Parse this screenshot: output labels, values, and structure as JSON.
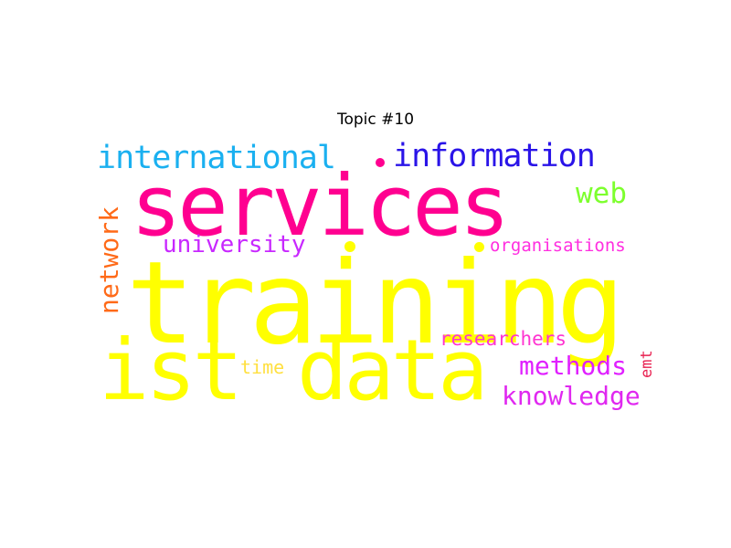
{
  "figure": {
    "title": "Topic #10"
  },
  "words": [
    {
      "text": "training",
      "color": "#ffff00"
    },
    {
      "text": "services",
      "color": "#ff0090"
    },
    {
      "text": "ist",
      "color": "#ffff00"
    },
    {
      "text": "data",
      "color": "#ffff00"
    },
    {
      "text": "international",
      "color": "#1ab0f0"
    },
    {
      "text": "information",
      "color": "#2a14e8"
    },
    {
      "text": "web",
      "color": "#7dff2e"
    },
    {
      "text": "network",
      "color": "#ff6a18"
    },
    {
      "text": "university",
      "color": "#c828ff"
    },
    {
      "text": "organisations",
      "color": "#ff2ee0"
    },
    {
      "text": "researchers",
      "color": "#ff34d0"
    },
    {
      "text": "methods",
      "color": "#e020ff"
    },
    {
      "text": "knowledge",
      "color": "#e028f0"
    },
    {
      "text": "emt",
      "color": "#e82050"
    },
    {
      "text": "time",
      "color": "#ffe040"
    }
  ]
}
